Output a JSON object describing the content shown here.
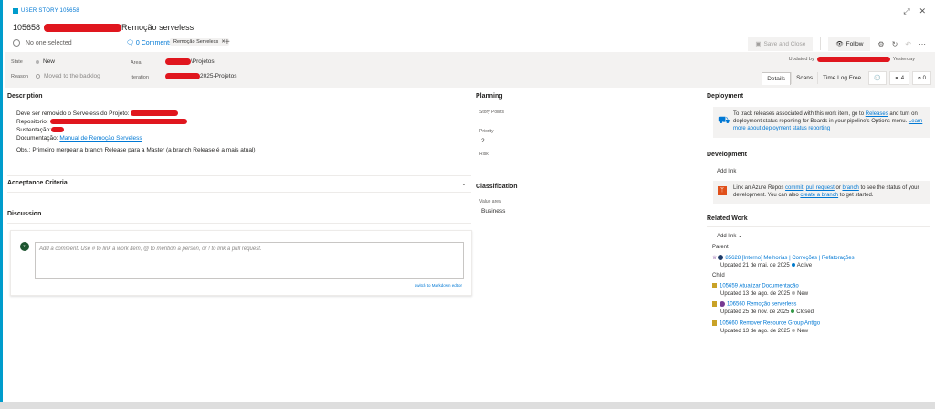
{
  "header": {
    "type_label": "USER STORY 105658",
    "id": "105658",
    "title": "Remoção serveless",
    "assignee": "No one selected",
    "comments": "0 Comments",
    "tag": "Remoção Serveless",
    "save_close": "Save and Close",
    "follow": "Follow"
  },
  "fields": {
    "state_label": "State",
    "state_value": "New",
    "reason_label": "Reason",
    "reason_value": "Moved to the backlog",
    "area_label": "Area",
    "area_value": "\\Projetos",
    "iteration_label": "Iteration",
    "iteration_value": "2025-Projetos",
    "updated_by": "Updated by",
    "updated_when": "Yesterday"
  },
  "tabs": {
    "details": "Details",
    "scans": "Scans",
    "time_log": "Time Log Free",
    "links_count": "4",
    "attach_count": "0"
  },
  "description": {
    "heading": "Description",
    "line1": "Deve ser removido o Serveless do Projeto:",
    "line2": "Repositorio:",
    "line3": "Sustentação:",
    "line4_prefix": "Documentação:",
    "line4_link": "Manual de Remoção Serveless",
    "line5": "Obs.: Primeiro mergear a branch Release para a Master (a branch Release é a mais atual)"
  },
  "acceptance": {
    "heading": "Acceptance Criteria"
  },
  "discussion": {
    "heading": "Discussion",
    "avatar": "TI",
    "placeholder": "Add a comment. Use # to link a work item, @ to mention a person, or ! to link a pull request.",
    "markdown_link": "switch to Markdown editor"
  },
  "planning": {
    "heading": "Planning",
    "story_points_label": "Story Points",
    "priority_label": "Priority",
    "priority_value": "2",
    "risk_label": "Risk"
  },
  "classification": {
    "heading": "Classification",
    "value_area_label": "Value area",
    "value_area_value": "Business"
  },
  "deployment": {
    "heading": "Deployment",
    "text1": "To track releases associated with this work item, go to",
    "link1": "Releases",
    "text2": "and turn on deployment status reporting for Boards in your pipeline's Options menu.",
    "link2": "Learn more about deployment status reporting"
  },
  "development": {
    "heading": "Development",
    "add_link": "Add link",
    "t1": "Link an Azure Repos",
    "l1": "commit",
    "l2": "pull request",
    "t2": "or",
    "l3": "branch",
    "t3": "to see the status of your development. You can also",
    "l4": "create a branch",
    "t4": "to get started."
  },
  "related": {
    "heading": "Related Work",
    "add_link": "Add link",
    "parent_label": "Parent",
    "child_label": "Child",
    "parent": {
      "title": "85628 [Interno] Melhorias | Correções | Refatorações",
      "updated": "Updated 21 de mai. de 2025",
      "state": "Active"
    },
    "children": [
      {
        "title": "105659 Atualizar Documentação",
        "updated": "Updated 13 de ago. de 2025",
        "state": "New"
      },
      {
        "title": "106560 Remoção serverless",
        "updated": "Updated 25 de nov. de 2025",
        "state": "Closed"
      },
      {
        "title": "105660 Remover Resource Group Antigo",
        "updated": "Updated 13 de ago. de 2025",
        "state": "New"
      }
    ]
  },
  "colors": {
    "accent": "#0078d4",
    "active": "#007acc",
    "closed": "#339947",
    "new": "#b2b2b2",
    "redact": "#e0161e"
  }
}
